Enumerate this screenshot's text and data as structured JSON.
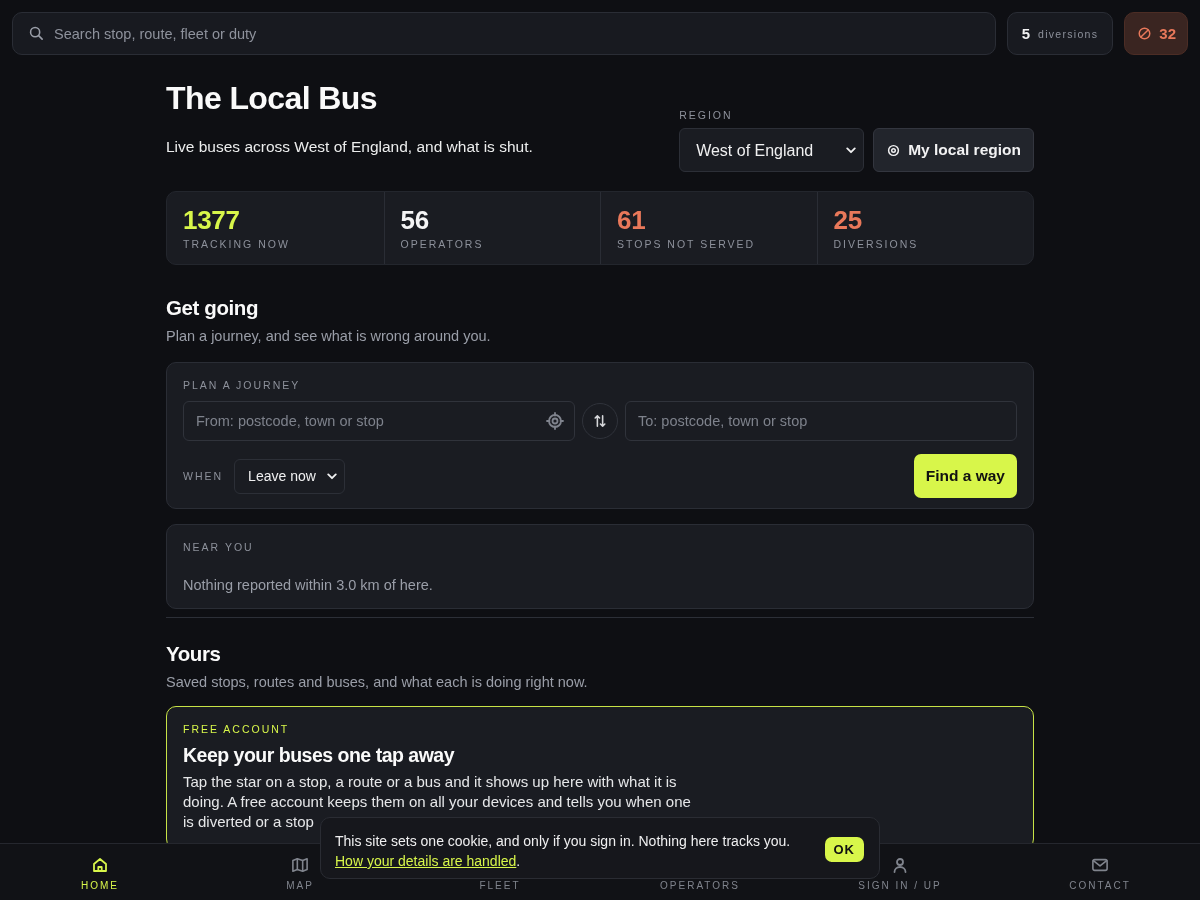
{
  "search": {
    "placeholder": "Search stop, route, fleet or duty"
  },
  "top_badges": [
    {
      "kind": "count",
      "value": "5",
      "label": "diversions"
    },
    {
      "kind": "alert",
      "value": "32"
    }
  ],
  "header": {
    "title": "The Local Bus",
    "subtitle": "Live buses across West of England, and what is shut.",
    "region": {
      "label": "REGION",
      "value": "West of England"
    },
    "locate_button": "My local region"
  },
  "stats": [
    {
      "value": "1377",
      "label": "TRACKING NOW",
      "color": "#d8f64a"
    },
    {
      "value": "56",
      "label": "OPERATORS",
      "color": "#f4f4f5"
    },
    {
      "value": "61",
      "label": "STOPS NOT SERVED",
      "color": "#e8785a"
    },
    {
      "value": "25",
      "label": "DIVERSIONS",
      "color": "#e8785a"
    }
  ],
  "get_going": {
    "title": "Get going",
    "subtitle": "Plan a journey, and see what is wrong around you.",
    "plan": {
      "label": "PLAN A JOURNEY",
      "from": {
        "placeholder": "From: postcode, town or stop"
      },
      "to": {
        "placeholder": "To: postcode, town or stop"
      },
      "when": {
        "label": "WHEN",
        "value": "Leave now"
      },
      "submit": "Find a way"
    },
    "near_you": {
      "label": "NEAR YOU",
      "message": "Nothing reported within 3.0 km of here."
    }
  },
  "yours": {
    "title": "Yours",
    "subtitle": "Saved stops, routes and buses, and what each is doing right now.",
    "promo": {
      "label": "FREE ACCOUNT",
      "title": "Keep your buses one tap away",
      "body": "Tap the star on a stop, a route or a bus and it shows up here with what it is doing. A free account keeps them on all your devices and tells you when one is diverted or a stop"
    }
  },
  "cookie_banner": {
    "text": "This site sets one cookie, and only if you sign in. Nothing here tracks you.",
    "link": "How your details are handled",
    "link_end": ".",
    "ok": "OK"
  },
  "nav": [
    {
      "label": "HOME",
      "selected": true
    },
    {
      "label": "MAP",
      "selected": false
    },
    {
      "label": "FLEET",
      "selected": false
    },
    {
      "label": "OPERATORS",
      "selected": false
    },
    {
      "label": "SIGN IN / UP",
      "selected": false
    },
    {
      "label": "CONTACT",
      "selected": false
    }
  ]
}
